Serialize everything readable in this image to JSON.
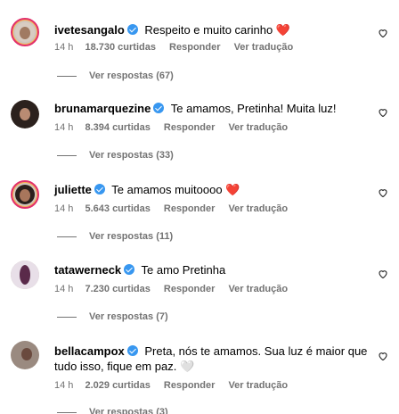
{
  "comments": [
    {
      "username": "ivetesangalo",
      "text": "Respeito e muito carinho",
      "emoji": "❤️",
      "time": "14 h",
      "likes": "18.730 curtidas",
      "reply": "Responder",
      "translate": "Ver tradução",
      "replies": "Ver respostas (67)"
    },
    {
      "username": "brunamarquezine",
      "text": "Te amamos, Pretinha! Muita luz!",
      "time": "14 h",
      "likes": "8.394 curtidas",
      "reply": "Responder",
      "translate": "Ver tradução",
      "replies": "Ver respostas (33)"
    },
    {
      "username": "juliette",
      "text": "Te amamos muitoooo",
      "emoji": "❤️",
      "time": "14 h",
      "likes": "5.643 curtidas",
      "reply": "Responder",
      "translate": "Ver tradução",
      "replies": "Ver respostas (11)"
    },
    {
      "username": "tatawerneck",
      "text": "Te amo Pretinha",
      "time": "14 h",
      "likes": "7.230 curtidas",
      "reply": "Responder",
      "translate": "Ver tradução",
      "replies": "Ver respostas (7)"
    },
    {
      "username": "bellacampox",
      "text_line1": "Preta, nós te amamos. Sua luz é maior que",
      "text_line2": "tudo isso, fique em paz.",
      "emoji": "🤍",
      "time": "14 h",
      "likes": "2.029 curtidas",
      "reply": "Responder",
      "translate": "Ver tradução",
      "replies": "Ver respostas (3)"
    }
  ],
  "colors": {
    "verified": "#3897f0",
    "meta_text": "#737373",
    "heart": "#ed4956"
  },
  "icons": [
    "verified-badge-icon",
    "heart-outline-icon"
  ]
}
